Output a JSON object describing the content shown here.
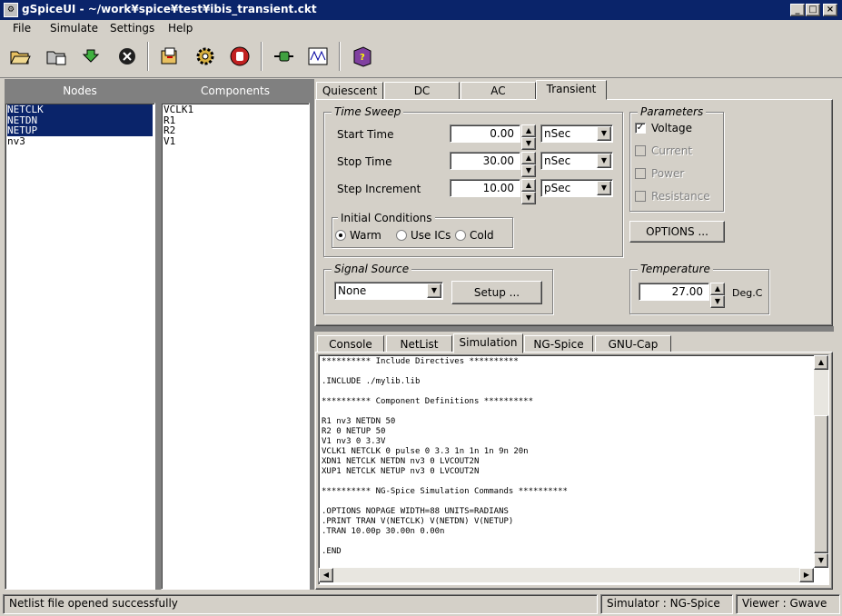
{
  "window": {
    "title": "gSpiceUI  -  ~/work¥spice¥test¥ibis_transient.ckt",
    "icon": "gspice-app-icon"
  },
  "menu": [
    "File",
    "Simulate",
    "Settings",
    "Help"
  ],
  "toolbar": [
    "open-folder-icon",
    "import-icon",
    "reload-icon",
    "close-icon",
    "create-netlist-icon",
    "settings-gear-icon",
    "stop-hand-icon",
    "simulate-plug-icon",
    "waveform-viewer-icon",
    "help-book-icon"
  ],
  "nodes": {
    "header": "Nodes",
    "items": [
      "NETCLK",
      "NETDN",
      "NETUP",
      "nv3"
    ],
    "selected": [
      0,
      1,
      2
    ]
  },
  "components": {
    "header": "Components",
    "items": [
      "VCLK1",
      "R1",
      "R2",
      "V1"
    ]
  },
  "analysis_tabs": [
    "Quiescent",
    "DC",
    "AC",
    "Transient"
  ],
  "active_analysis_tab": "Transient",
  "time_sweep": {
    "label": "Time Sweep",
    "start": {
      "label": "Start Time",
      "value": "0.00",
      "unit": "nSec"
    },
    "stop": {
      "label": "Stop Time",
      "value": "30.00",
      "unit": "nSec"
    },
    "step": {
      "label": "Step Increment",
      "value": "10.00",
      "unit": "pSec"
    }
  },
  "initial_conditions": {
    "label": "Initial Conditions",
    "options": [
      "Warm",
      "Use ICs",
      "Cold"
    ],
    "selected": "Warm"
  },
  "parameters": {
    "label": "Parameters",
    "voltage": "Voltage",
    "current": "Current",
    "power": "Power",
    "resistance": "Resistance",
    "options_button": "OPTIONS ..."
  },
  "signal_source": {
    "label": "Signal Source",
    "value": "None",
    "setup_button": "Setup ..."
  },
  "temperature": {
    "label": "Temperature",
    "value": "27.00",
    "unit": "Deg.C"
  },
  "output_tabs": [
    "Console",
    "NetList",
    "Simulation",
    "NG-Spice",
    "GNU-Cap"
  ],
  "active_output_tab": "Simulation",
  "console_lines": [
    "********** Include Directives **********",
    "",
    ".INCLUDE ./mylib.lib",
    "",
    "********** Component Definitions **********",
    "",
    "R1 nv3 NETDN 50",
    "R2 0 NETUP 50",
    "V1 nv3 0 3.3V",
    "VCLK1 NETCLK 0 pulse 0 3.3 1n 1n 1n 9n 20n",
    "XDN1 NETCLK NETDN nv3 0 LVCOUT2N",
    "XUP1 NETCLK NETUP nv3 0 LVCOUT2N",
    "",
    "********** NG-Spice Simulation Commands **********",
    "",
    ".OPTIONS NOPAGE WIDTH=88 UNITS=RADIANS",
    ".PRINT TRAN V(NETCLK) V(NETDN) V(NETUP)",
    ".TRAN 10.00p 30.00n 0.00n",
    "",
    ".END"
  ],
  "status": {
    "message": "Netlist file opened successfully",
    "simulator": "Simulator : NG-Spice",
    "viewer": "Viewer : Gwave"
  }
}
